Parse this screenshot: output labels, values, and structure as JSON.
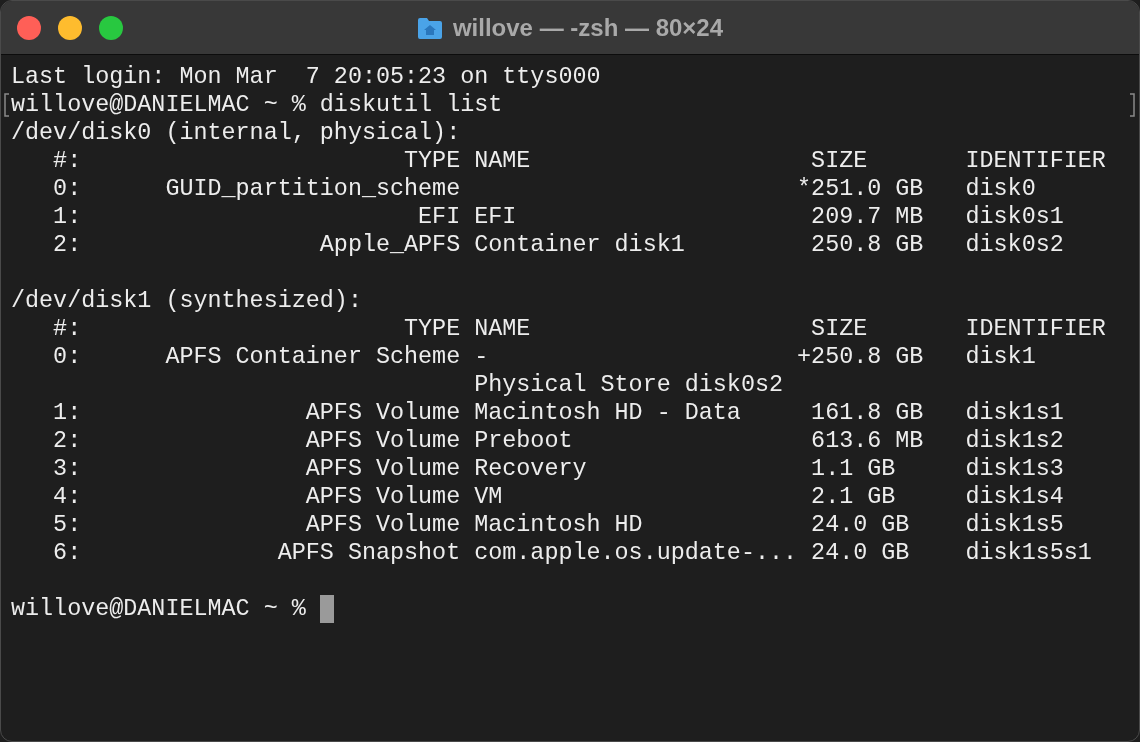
{
  "window": {
    "title": "willove — -zsh — 80×24"
  },
  "lines": [
    {
      "kind": "text",
      "text": "Last login: Mon Mar  7 20:05:23 on ttys000"
    },
    {
      "kind": "prompt",
      "text": "willove@DANIELMAC ~ % diskutil list",
      "cursor": false,
      "marked": true
    },
    {
      "kind": "text",
      "text": "/dev/disk0 (internal, physical):"
    },
    {
      "kind": "text",
      "text": "   #:                       TYPE NAME                    SIZE       IDENTIFIER"
    },
    {
      "kind": "text",
      "text": "   0:      GUID_partition_scheme                        *251.0 GB   disk0"
    },
    {
      "kind": "text",
      "text": "   1:                        EFI EFI                     209.7 MB   disk0s1"
    },
    {
      "kind": "text",
      "text": "   2:                 Apple_APFS Container disk1         250.8 GB   disk0s2"
    },
    {
      "kind": "blank"
    },
    {
      "kind": "text",
      "text": "/dev/disk1 (synthesized):"
    },
    {
      "kind": "text",
      "text": "   #:                       TYPE NAME                    SIZE       IDENTIFIER"
    },
    {
      "kind": "text",
      "text": "   0:      APFS Container Scheme -                      +250.8 GB   disk1"
    },
    {
      "kind": "text",
      "text": "                                 Physical Store disk0s2"
    },
    {
      "kind": "text",
      "text": "   1:                APFS Volume Macintosh HD - Data     161.8 GB   disk1s1"
    },
    {
      "kind": "text",
      "text": "   2:                APFS Volume Preboot                 613.6 MB   disk1s2"
    },
    {
      "kind": "text",
      "text": "   3:                APFS Volume Recovery                1.1 GB     disk1s3"
    },
    {
      "kind": "text",
      "text": "   4:                APFS Volume VM                      2.1 GB     disk1s4"
    },
    {
      "kind": "text",
      "text": "   5:                APFS Volume Macintosh HD            24.0 GB    disk1s5"
    },
    {
      "kind": "text",
      "text": "   6:              APFS Snapshot com.apple.os.update-... 24.0 GB    disk1s5s1"
    },
    {
      "kind": "blank"
    },
    {
      "kind": "prompt",
      "text": "willove@DANIELMAC ~ % ",
      "cursor": true,
      "marked": false
    }
  ]
}
